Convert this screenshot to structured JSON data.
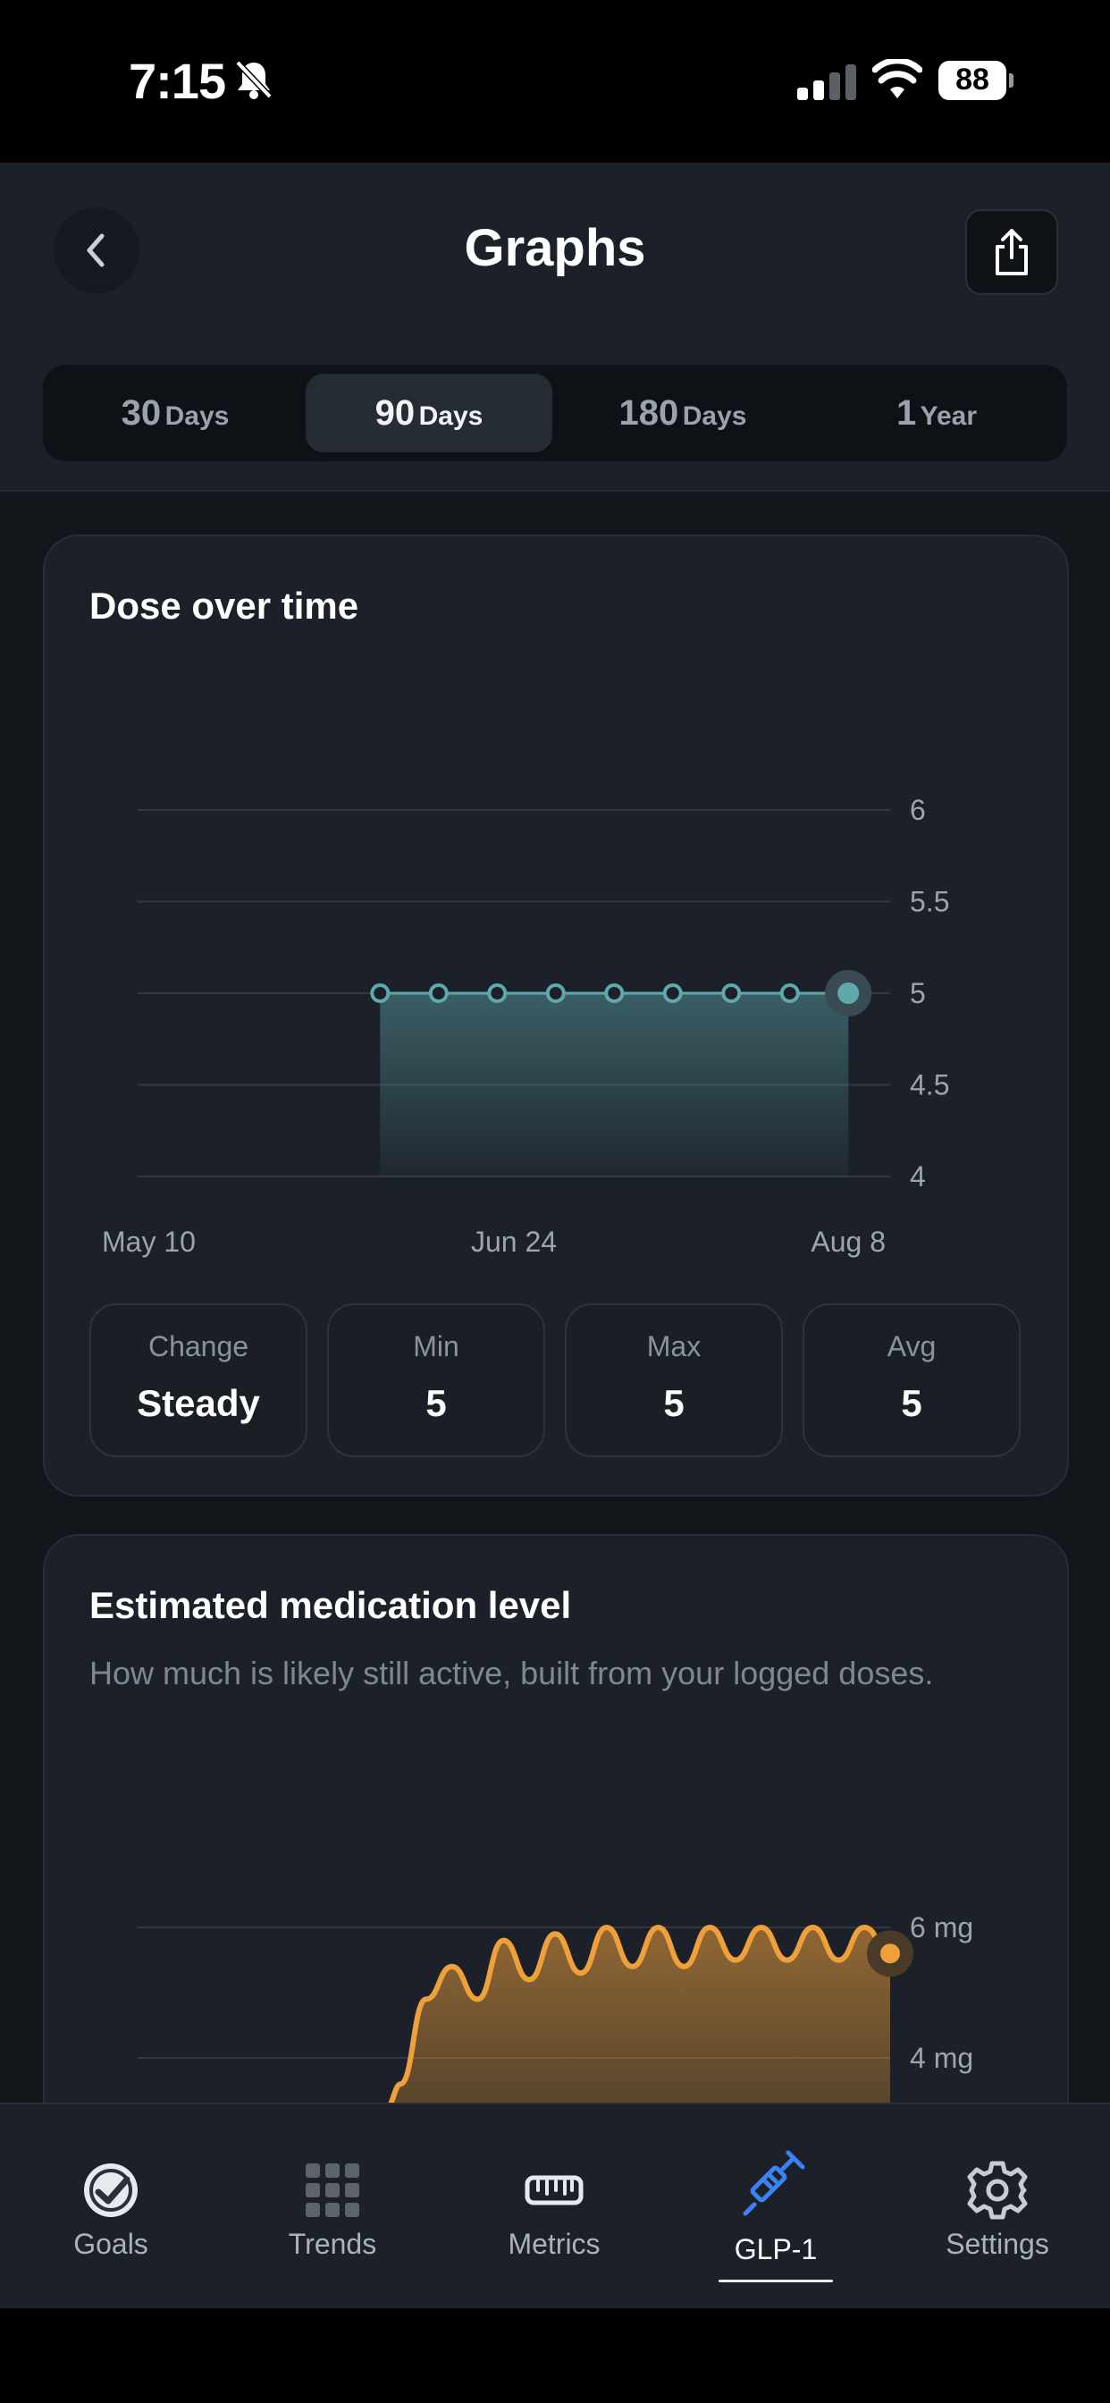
{
  "status_bar": {
    "time": "7:15",
    "battery": "88"
  },
  "header": {
    "title": "Graphs"
  },
  "ranges": [
    {
      "num": "30",
      "unit": "Days",
      "active": false
    },
    {
      "num": "90",
      "unit": "Days",
      "active": true
    },
    {
      "num": "180",
      "unit": "Days",
      "active": false
    },
    {
      "num": "1",
      "unit": "Year",
      "active": false
    }
  ],
  "dose_card": {
    "title": "Dose over time",
    "stats": [
      {
        "label": "Change",
        "value": "Steady"
      },
      {
        "label": "Min",
        "value": "5"
      },
      {
        "label": "Max",
        "value": "5"
      },
      {
        "label": "Avg",
        "value": "5"
      }
    ]
  },
  "level_card": {
    "title": "Estimated medication level",
    "subtitle": "How much is likely still active, built from your logged doses."
  },
  "chart_data": [
    {
      "type": "area",
      "title": "Dose over time",
      "x_ticks": [
        "May 10",
        "Jun 24",
        "Aug 8"
      ],
      "y_ticks": [
        "6",
        "5.5",
        "5",
        "4.5",
        "4"
      ],
      "ylim": [
        4,
        6
      ],
      "grid": true,
      "color": "#5fa9ad",
      "series": [
        {
          "x": [
            "2025-06-08",
            "2025-06-15",
            "2025-06-22",
            "2025-06-29",
            "2025-07-06",
            "2025-07-13",
            "2025-07-20",
            "2025-07-27",
            "2025-08-03"
          ],
          "values": [
            5,
            5,
            5,
            5,
            5,
            5,
            5,
            5,
            5
          ]
        }
      ]
    },
    {
      "type": "area",
      "title": "Estimated medication level",
      "y_ticks": [
        "6 mg",
        "4 mg"
      ],
      "grid": true,
      "color": "#f0a03a",
      "series": [
        {
          "values": [
            3.6,
            4.9,
            5.4,
            4.9,
            5.8,
            5.2,
            5.9,
            5.3,
            6.0,
            5.4,
            6.0,
            5.4,
            6.0,
            5.5,
            6.0,
            5.5,
            6.0,
            5.5,
            6.0,
            5.6
          ]
        }
      ]
    }
  ],
  "tabbar": [
    {
      "label": "Goals",
      "icon": "goals-check-icon",
      "active": false
    },
    {
      "label": "Trends",
      "icon": "grid-icon",
      "active": false
    },
    {
      "label": "Metrics",
      "icon": "ruler-icon",
      "active": false
    },
    {
      "label": "GLP-1",
      "icon": "syringe-icon",
      "active": true
    },
    {
      "label": "Settings",
      "icon": "gear-icon",
      "active": false
    }
  ],
  "colors": {
    "accent_teal": "#5fa9ad",
    "accent_orange": "#f0a03a",
    "accent_blue": "#3b82f6"
  }
}
